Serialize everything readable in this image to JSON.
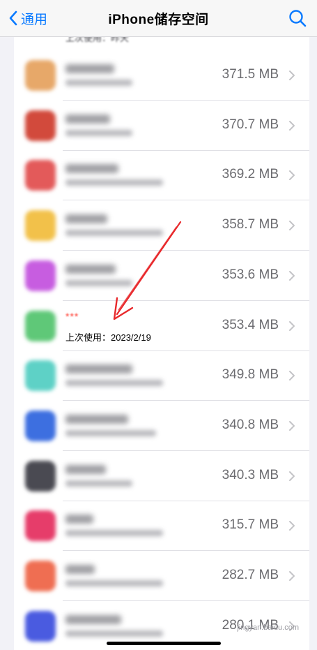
{
  "nav": {
    "back_label": "通用",
    "title": "iPhone储存空间"
  },
  "top_partial_row": {
    "sub": "上次使用：昨天"
  },
  "apps": [
    {
      "size": "371.5 MB",
      "icon_color": "#e7a869"
    },
    {
      "size": "370.7 MB",
      "icon_color": "#d24a3c"
    },
    {
      "size": "369.2 MB",
      "icon_color": "#e35a5a"
    },
    {
      "size": "358.7 MB",
      "icon_color": "#f2c14a"
    },
    {
      "size": "353.6 MB",
      "icon_color": "#c75de0"
    },
    {
      "name": "***",
      "last_used": "上次使用：2023/2/19",
      "size": "353.4 MB",
      "icon_color": "#5fc878"
    },
    {
      "size": "349.8 MB",
      "icon_color": "#5ed1c6"
    },
    {
      "size": "340.8 MB",
      "icon_color": "#3d6fe0"
    },
    {
      "size": "340.3 MB",
      "icon_color": "#4a4a52"
    },
    {
      "size": "315.7 MB",
      "icon_color": "#e63d6a"
    },
    {
      "size": "282.7 MB",
      "icon_color": "#ef6e52"
    },
    {
      "size": "280.1 MB",
      "icon_color": "#4a5be0"
    }
  ],
  "watermark": "jingyan.baidu.com",
  "colors": {
    "accent": "#0a7aff",
    "arrow": "#e8282b",
    "highlight_name": "#ff3b30"
  }
}
